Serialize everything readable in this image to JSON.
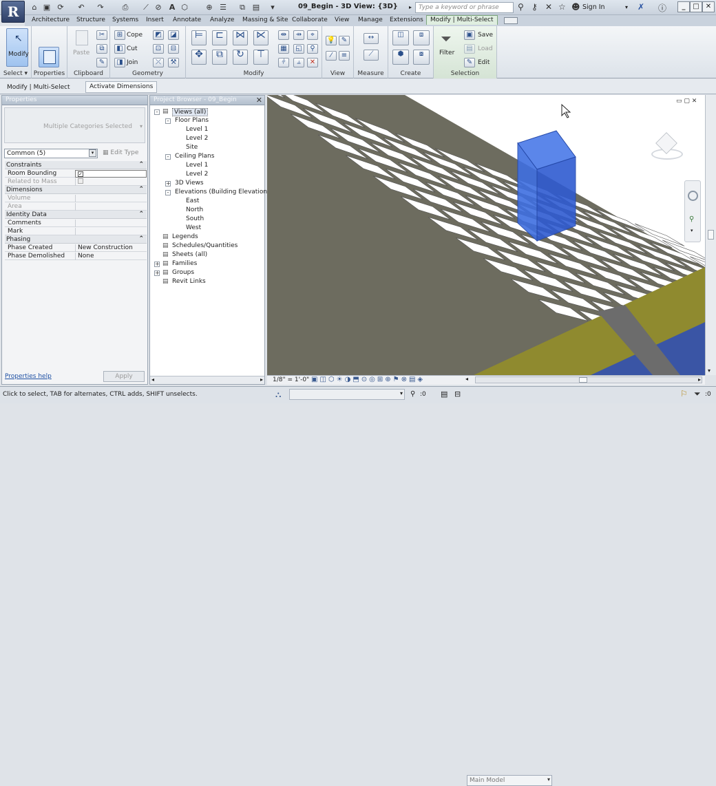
{
  "app": {
    "title": "09_Begin - 3D View: {3D}",
    "search_placeholder": "Type a keyword or phrase",
    "sign_in": "Sign In"
  },
  "tabs": [
    "Architecture",
    "Structure",
    "Systems",
    "Insert",
    "Annotate",
    "Analyze",
    "Massing & Site",
    "Collaborate",
    "View",
    "Manage",
    "Extensions",
    "Modify | Multi-Select"
  ],
  "ribbon": {
    "select": {
      "modify": "Modify",
      "label": "Select"
    },
    "properties": {
      "label": "Properties"
    },
    "clipboard": {
      "paste": "Paste",
      "label": "Clipboard"
    },
    "geometry": {
      "cope": "Cope",
      "cut": "Cut",
      "join": "Join",
      "label": "Geometry"
    },
    "modify": {
      "label": "Modify"
    },
    "view": {
      "label": "View"
    },
    "measure": {
      "label": "Measure"
    },
    "create": {
      "label": "Create"
    },
    "selection": {
      "filter": "Filter",
      "save": "Save",
      "load": "Load",
      "edit": "Edit",
      "label": "Selection"
    }
  },
  "options_bar": {
    "context": "Modify | Multi-Select",
    "activate_dimensions": "Activate Dimensions"
  },
  "properties": {
    "title": "Properties",
    "type_selector": "Multiple Categories Selected",
    "filter": "Common (5)",
    "edit_type": "Edit Type",
    "sections": [
      {
        "name": "Constraints",
        "rows": [
          {
            "label": "Room Bounding",
            "value": "",
            "check": true
          },
          {
            "label": "Related to Mass",
            "value": "",
            "check": false,
            "dim": true
          }
        ]
      },
      {
        "name": "Dimensions",
        "rows": [
          {
            "label": "Volume",
            "value": "",
            "dim": true
          },
          {
            "label": "Area",
            "value": "",
            "dim": true
          }
        ]
      },
      {
        "name": "Identity Data",
        "rows": [
          {
            "label": "Comments",
            "value": ""
          },
          {
            "label": "Mark",
            "value": ""
          }
        ]
      },
      {
        "name": "Phasing",
        "rows": [
          {
            "label": "Phase Created",
            "value": "New Construction"
          },
          {
            "label": "Phase Demolished",
            "value": "None"
          }
        ]
      }
    ],
    "help": "Properties help",
    "apply": "Apply"
  },
  "browser": {
    "title": "Project Browser - 09_Begin",
    "items": [
      {
        "label": "Views (all)",
        "depth": 0,
        "toggle": "-"
      },
      {
        "label": "Floor Plans",
        "depth": 1,
        "toggle": "-"
      },
      {
        "label": "Level 1",
        "depth": 2
      },
      {
        "label": "Level 2",
        "depth": 2
      },
      {
        "label": "Site",
        "depth": 2
      },
      {
        "label": "Ceiling Plans",
        "depth": 1,
        "toggle": "-"
      },
      {
        "label": "Level 1",
        "depth": 2
      },
      {
        "label": "Level 2",
        "depth": 2
      },
      {
        "label": "3D Views",
        "depth": 1,
        "toggle": "+"
      },
      {
        "label": "Elevations (Building Elevation",
        "depth": 1,
        "toggle": "-"
      },
      {
        "label": "East",
        "depth": 2
      },
      {
        "label": "North",
        "depth": 2
      },
      {
        "label": "South",
        "depth": 2
      },
      {
        "label": "West",
        "depth": 2
      },
      {
        "label": "Legends",
        "depth": 0
      },
      {
        "label": "Schedules/Quantities",
        "depth": 0
      },
      {
        "label": "Sheets (all)",
        "depth": 0
      },
      {
        "label": "Families",
        "depth": 0,
        "toggle": "+"
      },
      {
        "label": "Groups",
        "depth": 0,
        "toggle": "+"
      },
      {
        "label": "Revit Links",
        "depth": 0
      }
    ]
  },
  "view": {
    "scale": "1/8\" = 1'-0\""
  },
  "status": {
    "message": "Click to select, TAB for alternates, CTRL adds, SHIFT unselects.",
    "counter": ":0",
    "model": "Main Model",
    "filter_count": ":0"
  },
  "colors": {
    "accent": "#3f6fe0",
    "active_tab": "#dfeee0",
    "floor": "#6d6c58",
    "slab": "#8f8a2f"
  }
}
